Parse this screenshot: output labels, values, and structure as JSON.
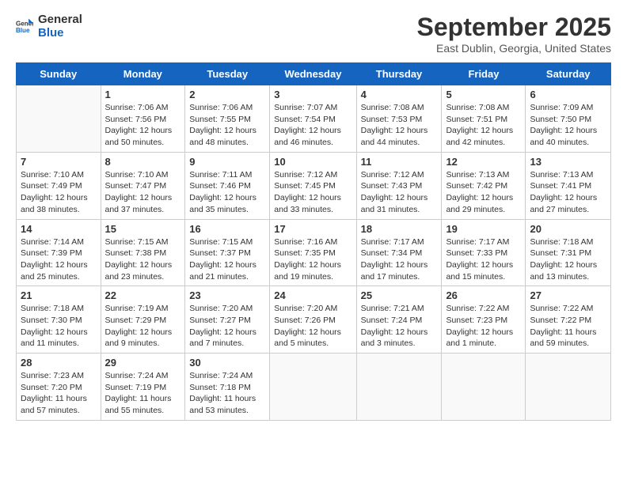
{
  "header": {
    "logo_general": "General",
    "logo_blue": "Blue",
    "month_title": "September 2025",
    "location": "East Dublin, Georgia, United States"
  },
  "weekdays": [
    "Sunday",
    "Monday",
    "Tuesday",
    "Wednesday",
    "Thursday",
    "Friday",
    "Saturday"
  ],
  "weeks": [
    [
      {
        "day": "",
        "info": ""
      },
      {
        "day": "1",
        "info": "Sunrise: 7:06 AM\nSunset: 7:56 PM\nDaylight: 12 hours\nand 50 minutes."
      },
      {
        "day": "2",
        "info": "Sunrise: 7:06 AM\nSunset: 7:55 PM\nDaylight: 12 hours\nand 48 minutes."
      },
      {
        "day": "3",
        "info": "Sunrise: 7:07 AM\nSunset: 7:54 PM\nDaylight: 12 hours\nand 46 minutes."
      },
      {
        "day": "4",
        "info": "Sunrise: 7:08 AM\nSunset: 7:53 PM\nDaylight: 12 hours\nand 44 minutes."
      },
      {
        "day": "5",
        "info": "Sunrise: 7:08 AM\nSunset: 7:51 PM\nDaylight: 12 hours\nand 42 minutes."
      },
      {
        "day": "6",
        "info": "Sunrise: 7:09 AM\nSunset: 7:50 PM\nDaylight: 12 hours\nand 40 minutes."
      }
    ],
    [
      {
        "day": "7",
        "info": "Sunrise: 7:10 AM\nSunset: 7:49 PM\nDaylight: 12 hours\nand 38 minutes."
      },
      {
        "day": "8",
        "info": "Sunrise: 7:10 AM\nSunset: 7:47 PM\nDaylight: 12 hours\nand 37 minutes."
      },
      {
        "day": "9",
        "info": "Sunrise: 7:11 AM\nSunset: 7:46 PM\nDaylight: 12 hours\nand 35 minutes."
      },
      {
        "day": "10",
        "info": "Sunrise: 7:12 AM\nSunset: 7:45 PM\nDaylight: 12 hours\nand 33 minutes."
      },
      {
        "day": "11",
        "info": "Sunrise: 7:12 AM\nSunset: 7:43 PM\nDaylight: 12 hours\nand 31 minutes."
      },
      {
        "day": "12",
        "info": "Sunrise: 7:13 AM\nSunset: 7:42 PM\nDaylight: 12 hours\nand 29 minutes."
      },
      {
        "day": "13",
        "info": "Sunrise: 7:13 AM\nSunset: 7:41 PM\nDaylight: 12 hours\nand 27 minutes."
      }
    ],
    [
      {
        "day": "14",
        "info": "Sunrise: 7:14 AM\nSunset: 7:39 PM\nDaylight: 12 hours\nand 25 minutes."
      },
      {
        "day": "15",
        "info": "Sunrise: 7:15 AM\nSunset: 7:38 PM\nDaylight: 12 hours\nand 23 minutes."
      },
      {
        "day": "16",
        "info": "Sunrise: 7:15 AM\nSunset: 7:37 PM\nDaylight: 12 hours\nand 21 minutes."
      },
      {
        "day": "17",
        "info": "Sunrise: 7:16 AM\nSunset: 7:35 PM\nDaylight: 12 hours\nand 19 minutes."
      },
      {
        "day": "18",
        "info": "Sunrise: 7:17 AM\nSunset: 7:34 PM\nDaylight: 12 hours\nand 17 minutes."
      },
      {
        "day": "19",
        "info": "Sunrise: 7:17 AM\nSunset: 7:33 PM\nDaylight: 12 hours\nand 15 minutes."
      },
      {
        "day": "20",
        "info": "Sunrise: 7:18 AM\nSunset: 7:31 PM\nDaylight: 12 hours\nand 13 minutes."
      }
    ],
    [
      {
        "day": "21",
        "info": "Sunrise: 7:18 AM\nSunset: 7:30 PM\nDaylight: 12 hours\nand 11 minutes."
      },
      {
        "day": "22",
        "info": "Sunrise: 7:19 AM\nSunset: 7:29 PM\nDaylight: 12 hours\nand 9 minutes."
      },
      {
        "day": "23",
        "info": "Sunrise: 7:20 AM\nSunset: 7:27 PM\nDaylight: 12 hours\nand 7 minutes."
      },
      {
        "day": "24",
        "info": "Sunrise: 7:20 AM\nSunset: 7:26 PM\nDaylight: 12 hours\nand 5 minutes."
      },
      {
        "day": "25",
        "info": "Sunrise: 7:21 AM\nSunset: 7:24 PM\nDaylight: 12 hours\nand 3 minutes."
      },
      {
        "day": "26",
        "info": "Sunrise: 7:22 AM\nSunset: 7:23 PM\nDaylight: 12 hours\nand 1 minute."
      },
      {
        "day": "27",
        "info": "Sunrise: 7:22 AM\nSunset: 7:22 PM\nDaylight: 11 hours\nand 59 minutes."
      }
    ],
    [
      {
        "day": "28",
        "info": "Sunrise: 7:23 AM\nSunset: 7:20 PM\nDaylight: 11 hours\nand 57 minutes."
      },
      {
        "day": "29",
        "info": "Sunrise: 7:24 AM\nSunset: 7:19 PM\nDaylight: 11 hours\nand 55 minutes."
      },
      {
        "day": "30",
        "info": "Sunrise: 7:24 AM\nSunset: 7:18 PM\nDaylight: 11 hours\nand 53 minutes."
      },
      {
        "day": "",
        "info": ""
      },
      {
        "day": "",
        "info": ""
      },
      {
        "day": "",
        "info": ""
      },
      {
        "day": "",
        "info": ""
      }
    ]
  ]
}
